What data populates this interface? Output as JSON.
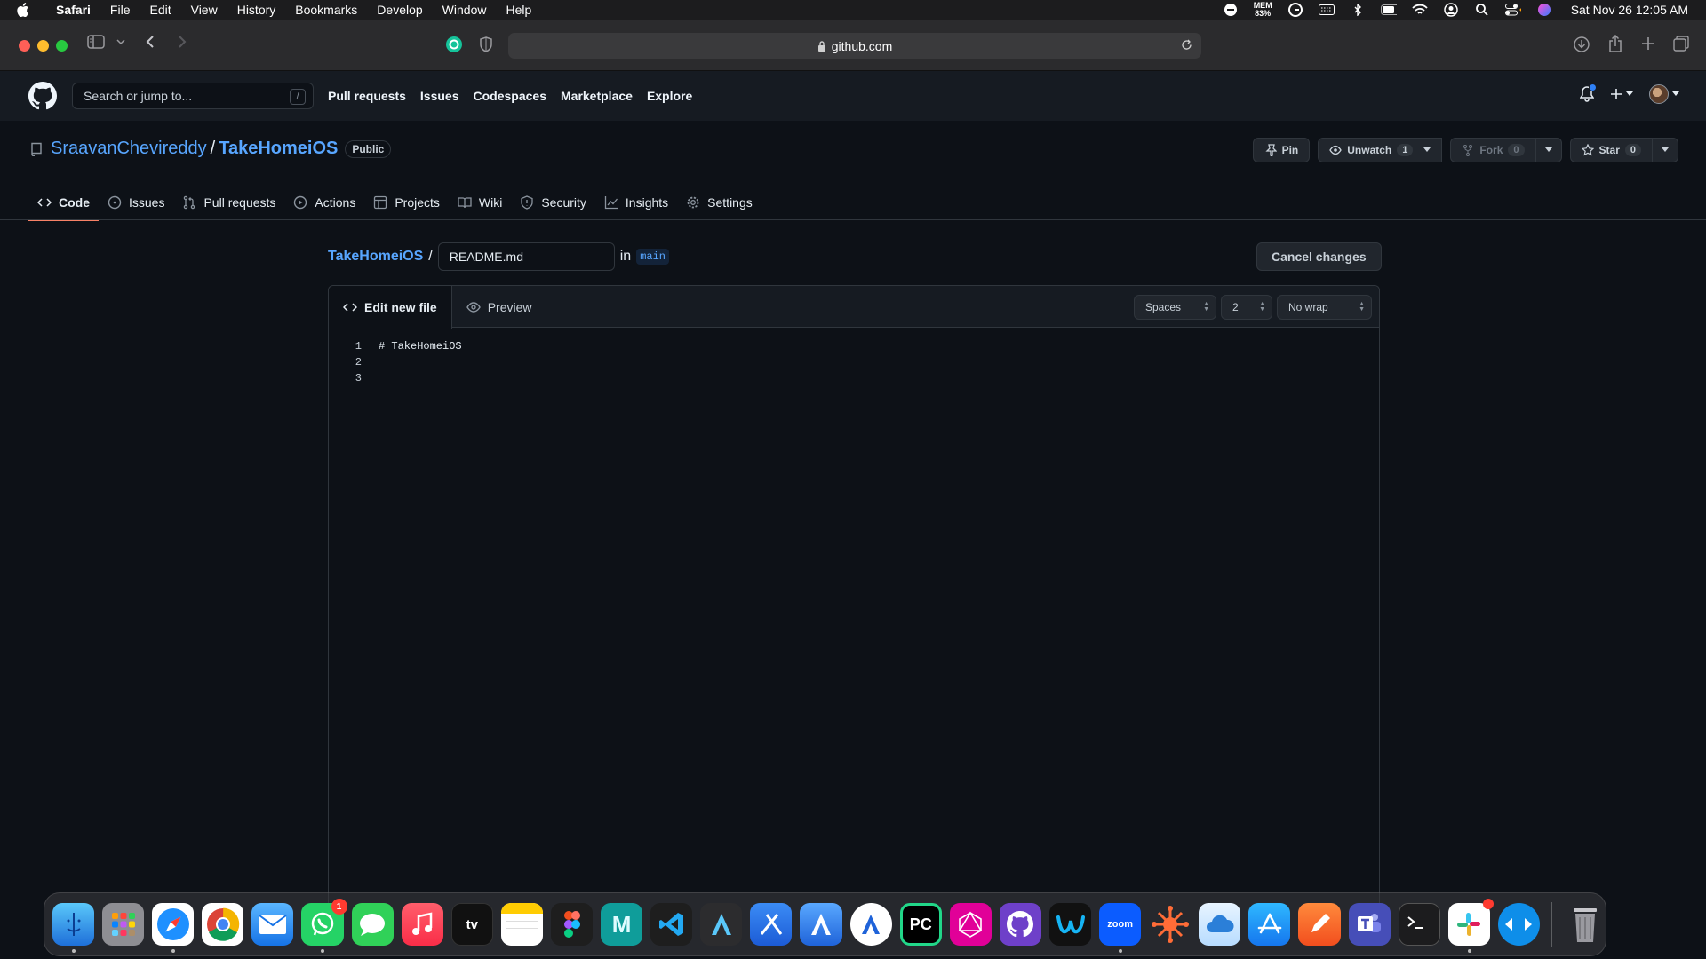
{
  "menubar": {
    "app": "Safari",
    "items": [
      "File",
      "Edit",
      "View",
      "History",
      "Bookmarks",
      "Develop",
      "Window",
      "Help"
    ],
    "mem_label": "MEM",
    "mem_value": "83%",
    "clock": "Sat Nov 26  12:05 AM"
  },
  "browser": {
    "url": "github.com"
  },
  "github": {
    "search_placeholder": "Search or jump to...",
    "search_shortcut": "/",
    "nav": [
      "Pull requests",
      "Issues",
      "Codespaces",
      "Marketplace",
      "Explore"
    ]
  },
  "repo": {
    "owner": "SraavanChevireddy",
    "separator": "/",
    "name": "TakeHomeiOS",
    "visibility": "Public",
    "pin_label": "Pin",
    "watch_label": "Unwatch",
    "watch_count": "1",
    "fork_label": "Fork",
    "fork_count": "0",
    "star_label": "Star",
    "star_count": "0",
    "tabs": [
      "Code",
      "Issues",
      "Pull requests",
      "Actions",
      "Projects",
      "Wiki",
      "Security",
      "Insights",
      "Settings"
    ],
    "active_tab": "Code"
  },
  "editor": {
    "repo_link": "TakeHomeiOS",
    "path_separator": "/",
    "filename": "README.md",
    "in_label": "in",
    "branch": "main",
    "cancel_label": "Cancel changes",
    "tab_edit": "Edit new file",
    "tab_preview": "Preview",
    "indent_mode": "Spaces",
    "indent_size": "2",
    "wrap_mode": "No wrap",
    "lines": [
      {
        "num": "1",
        "text": "# TakeHomeiOS"
      },
      {
        "num": "2",
        "text": ""
      },
      {
        "num": "3",
        "text": ""
      }
    ]
  },
  "dock": {
    "apps": [
      "Finder",
      "Launchpad",
      "Safari",
      "Chrome",
      "Mail",
      "WhatsApp",
      "Messages",
      "Music",
      "TV",
      "Notes",
      "Figma",
      "Mindnode",
      "VS Code",
      "Instruments",
      "Xcode",
      "Xcode Beta",
      "Creator",
      "PyCharm",
      "GraphQL",
      "GitHub Desktop",
      "Webex",
      "Zoom",
      "Postman",
      "Cloud",
      "App Store",
      "Pencil",
      "Teams",
      "Terminal",
      "Slack",
      "TeamViewer",
      "Trash"
    ],
    "whatsapp_badge": "1",
    "tv_label": "tv",
    "zoom_label": "zoom",
    "pycharm_label": "PC"
  },
  "colors": {
    "accent_link": "#58a6ff",
    "tab_underline": "#f78166",
    "page_bg": "#0d1117"
  }
}
